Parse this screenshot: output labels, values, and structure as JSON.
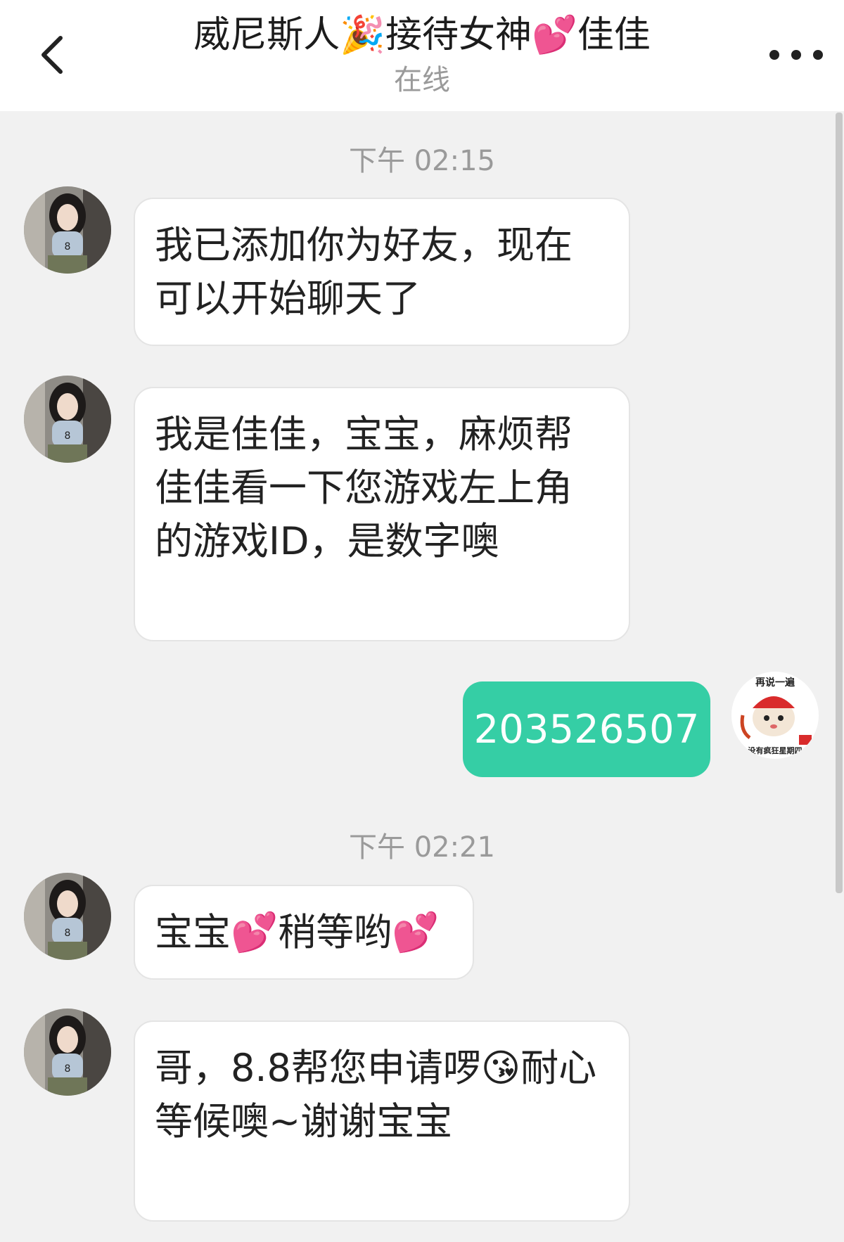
{
  "header": {
    "title": "威尼斯人🎉接待女神💕佳佳",
    "status": "在线",
    "back_icon": "chevron-left-icon",
    "more_icon": "more-dots-icon"
  },
  "messages": [
    {
      "type": "timestamp",
      "text": "下午 02:15"
    },
    {
      "type": "incoming",
      "text": "我已添加你为好友，现在\n可以开始聊天了"
    },
    {
      "type": "incoming",
      "text": "我是佳佳，宝宝，麻烦帮\n佳佳看一下您游戏左上角\n的游戏ID，是数字噢"
    },
    {
      "type": "outgoing",
      "text": "203526507"
    },
    {
      "type": "timestamp",
      "text": "下午 02:21"
    },
    {
      "type": "incoming",
      "text": "宝宝💕稍等哟💕"
    },
    {
      "type": "incoming",
      "text": "哥，8.8帮您申请啰😘耐心\n等候噢~谢谢宝宝"
    }
  ],
  "my_avatar": {
    "top_caption": "再说一遍",
    "bottom_caption": "没有疯狂星期四"
  },
  "colors": {
    "outgoing_bubble": "#35cea5",
    "background": "#f1f1f1"
  }
}
